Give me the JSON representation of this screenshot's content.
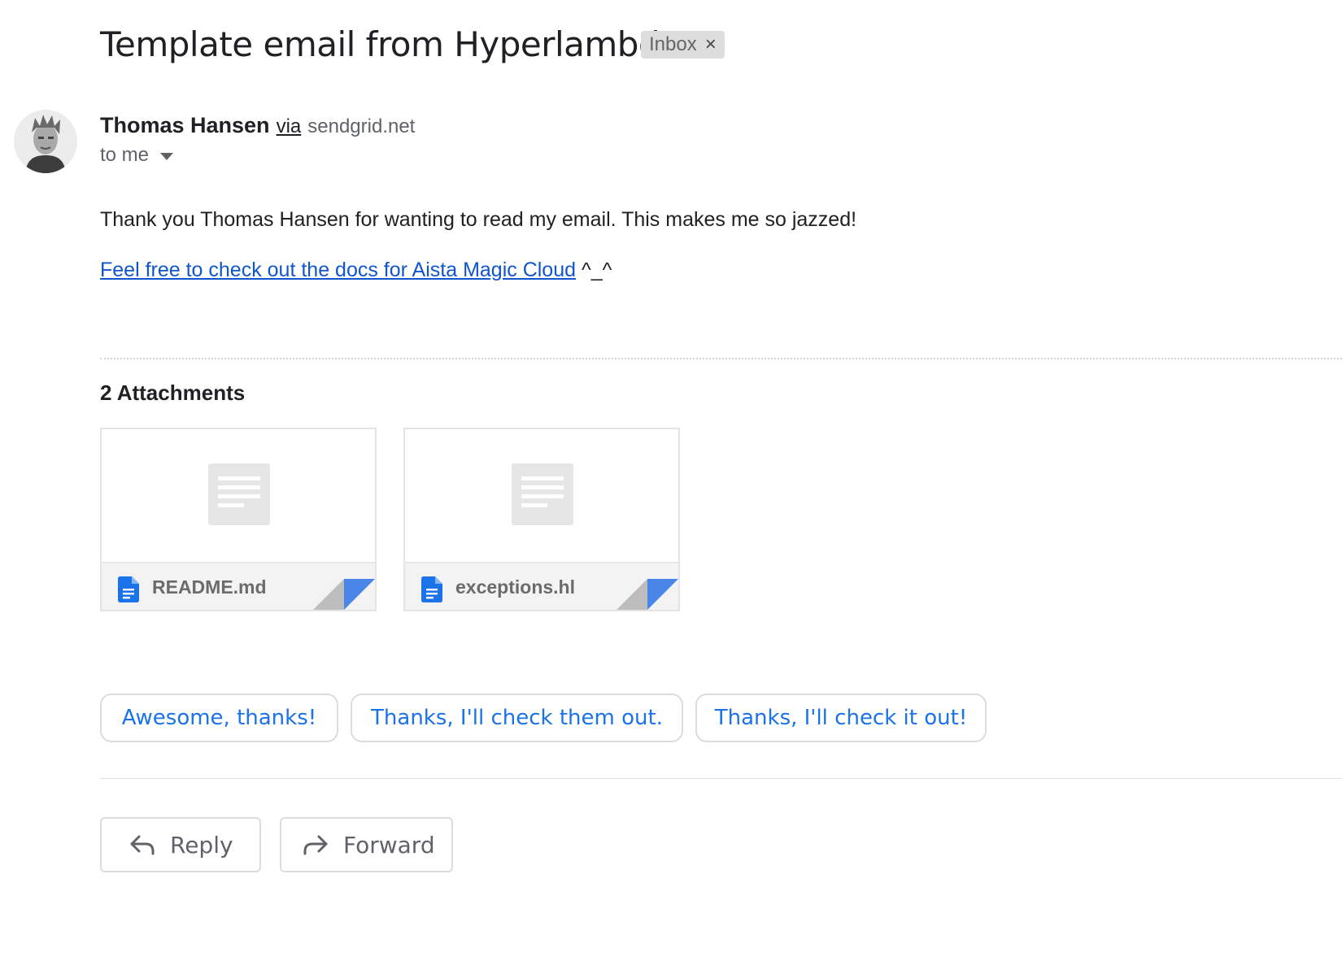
{
  "email": {
    "subject": "Template email from Hyperlambda",
    "label": {
      "text": "Inbox",
      "remove_glyph": "×"
    },
    "sender": {
      "name": "Thomas Hansen",
      "via": "via",
      "domain": "sendgrid.net"
    },
    "recipient": "to me",
    "body": {
      "paragraph": "Thank you Thomas Hansen for wanting to read my email. This makes me so jazzed!",
      "link_text": "Feel free to check out the docs for Aista Magic Cloud",
      "link_suffix": " ^_^"
    }
  },
  "attachments": {
    "header": "2 Attachments",
    "items": [
      {
        "name": "README.md"
      },
      {
        "name": "exceptions.hl"
      }
    ]
  },
  "smart_replies": [
    "Awesome, thanks!",
    "Thanks, I'll check them out.",
    "Thanks, I'll check it out!"
  ],
  "actions": {
    "reply_label": "Reply",
    "forward_label": "Forward"
  },
  "colors": {
    "link": "#1155cc",
    "smart_reply_text": "#1a73e8",
    "file_icon": "#1a73e8",
    "label_chip_bg": "#dddddd"
  },
  "icons": {
    "remove_label": "close-icon",
    "recipient_details": "chevron-down-icon",
    "attachment_preview": "document-preview-icon",
    "attachment_file": "google-docs-file-icon",
    "reply": "reply-arrow-icon",
    "forward": "forward-arrow-icon"
  }
}
